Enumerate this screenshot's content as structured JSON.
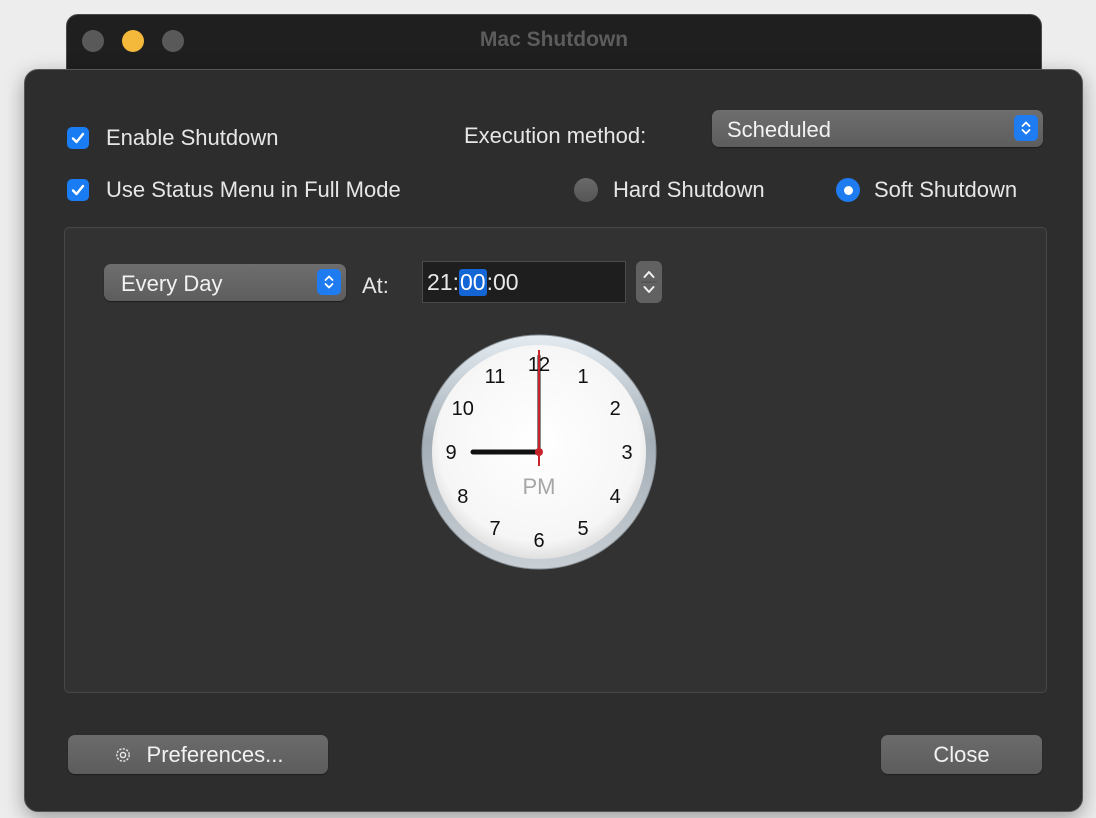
{
  "window": {
    "title": "Mac Shutdown"
  },
  "options": {
    "enable_shutdown_label": "Enable Shutdown",
    "enable_shutdown_checked": true,
    "status_menu_label": "Use Status Menu in Full Mode",
    "status_menu_checked": true
  },
  "execution": {
    "label": "Execution method:",
    "value": "Scheduled"
  },
  "mode": {
    "hard_label": "Hard Shutdown",
    "soft_label": "Soft Shutdown",
    "selected": "soft"
  },
  "schedule": {
    "frequency": "Every Day",
    "at_label": "At:",
    "time_hours": "21",
    "time_minutes": "00",
    "time_seconds": "00",
    "selected_segment": "minutes"
  },
  "clock": {
    "numerals": [
      "12",
      "1",
      "2",
      "3",
      "4",
      "5",
      "6",
      "7",
      "8",
      "9",
      "10",
      "11"
    ],
    "period": "PM",
    "hour": 21,
    "minute": 0,
    "second": 0
  },
  "footer": {
    "preferences_label": "Preferences...",
    "close_label": "Close"
  },
  "colors": {
    "accent": "#1f7cf0",
    "sheet_bg": "#2d2d2d",
    "second_hand": "#c8252b",
    "minimize": "#f4b83a"
  },
  "icons": {
    "preferences": "gear-icon"
  }
}
